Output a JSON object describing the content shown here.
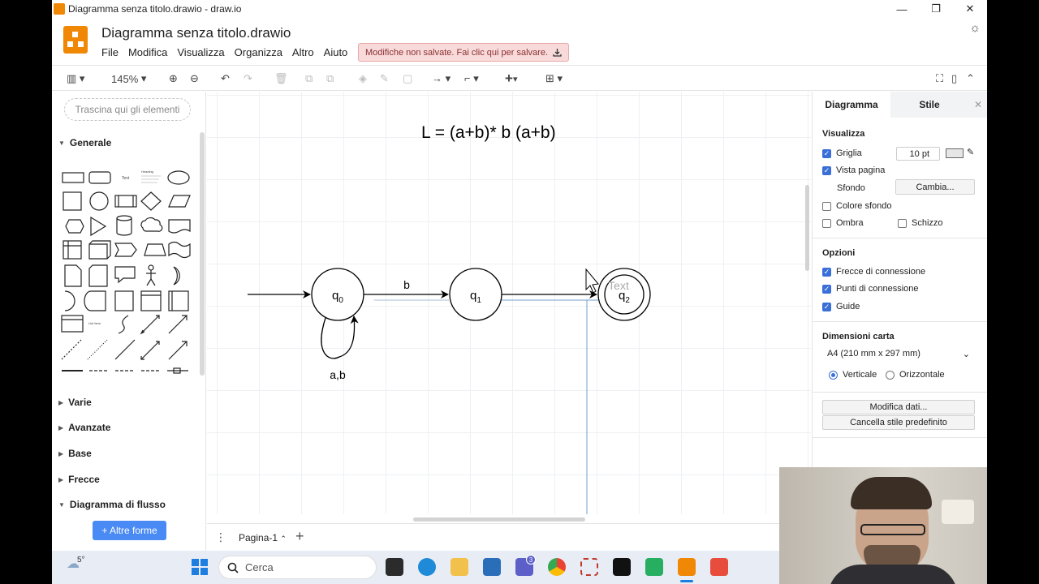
{
  "window": {
    "title": "Diagramma senza titolo.drawio - draw.io",
    "minimize": "—",
    "maximize": "❐",
    "close": "✕"
  },
  "header": {
    "doc_title": "Diagramma senza titolo.drawio",
    "menu": [
      "File",
      "Modifica",
      "Visualizza",
      "Organizza",
      "Altro",
      "Aiuto"
    ],
    "unsaved_notice": "Modifiche non salvate. Fai clic qui per salvare."
  },
  "toolbar": {
    "zoom": "145%"
  },
  "sidebar": {
    "search_placeholder": "Trascina qui gli elementi",
    "sections": [
      {
        "label": "Generale",
        "expanded": true
      },
      {
        "label": "Varie",
        "expanded": false
      },
      {
        "label": "Avanzate",
        "expanded": false
      },
      {
        "label": "Base",
        "expanded": false
      },
      {
        "label": "Frecce",
        "expanded": false
      },
      {
        "label": "Diagramma di flusso",
        "expanded": true
      }
    ],
    "more_shapes": "+ Altre forme",
    "shape_text_labels": {
      "text": "Text",
      "heading": "Heading",
      "list": "List Item"
    }
  },
  "canvas": {
    "formula": "L = (a+b)* b (a+b)",
    "states": [
      {
        "name": "q",
        "sub": "0"
      },
      {
        "name": "q",
        "sub": "1"
      },
      {
        "name": "q",
        "sub": "2"
      }
    ],
    "edge_b_label": "b",
    "loop_label": "a,b",
    "text_placeholder": "Text"
  },
  "pagebar": {
    "page_tab": "Pagina-1",
    "add": "+"
  },
  "panel": {
    "tab_diagram": "Diagramma",
    "tab_style": "Stile",
    "section_view": "Visualizza",
    "grid": "Griglia",
    "grid_size": "10 pt",
    "page_view": "Vista pagina",
    "background": "Sfondo",
    "change": "Cambia...",
    "bg_color": "Colore sfondo",
    "shadow": "Ombra",
    "sketch": "Schizzo",
    "section_options": "Opzioni",
    "connection_arrows": "Frecce di connessione",
    "connection_points": "Punti di connessione",
    "guides": "Guide",
    "section_paper": "Dimensioni carta",
    "paper_size": "A4 (210 mm x 297 mm)",
    "portrait": "Verticale",
    "landscape": "Orizzontale",
    "edit_data": "Modifica dati...",
    "clear_style": "Cancella stile predefinito"
  },
  "taskbar": {
    "weather": "5°",
    "search": "Cerca",
    "teams_badge": "3"
  }
}
